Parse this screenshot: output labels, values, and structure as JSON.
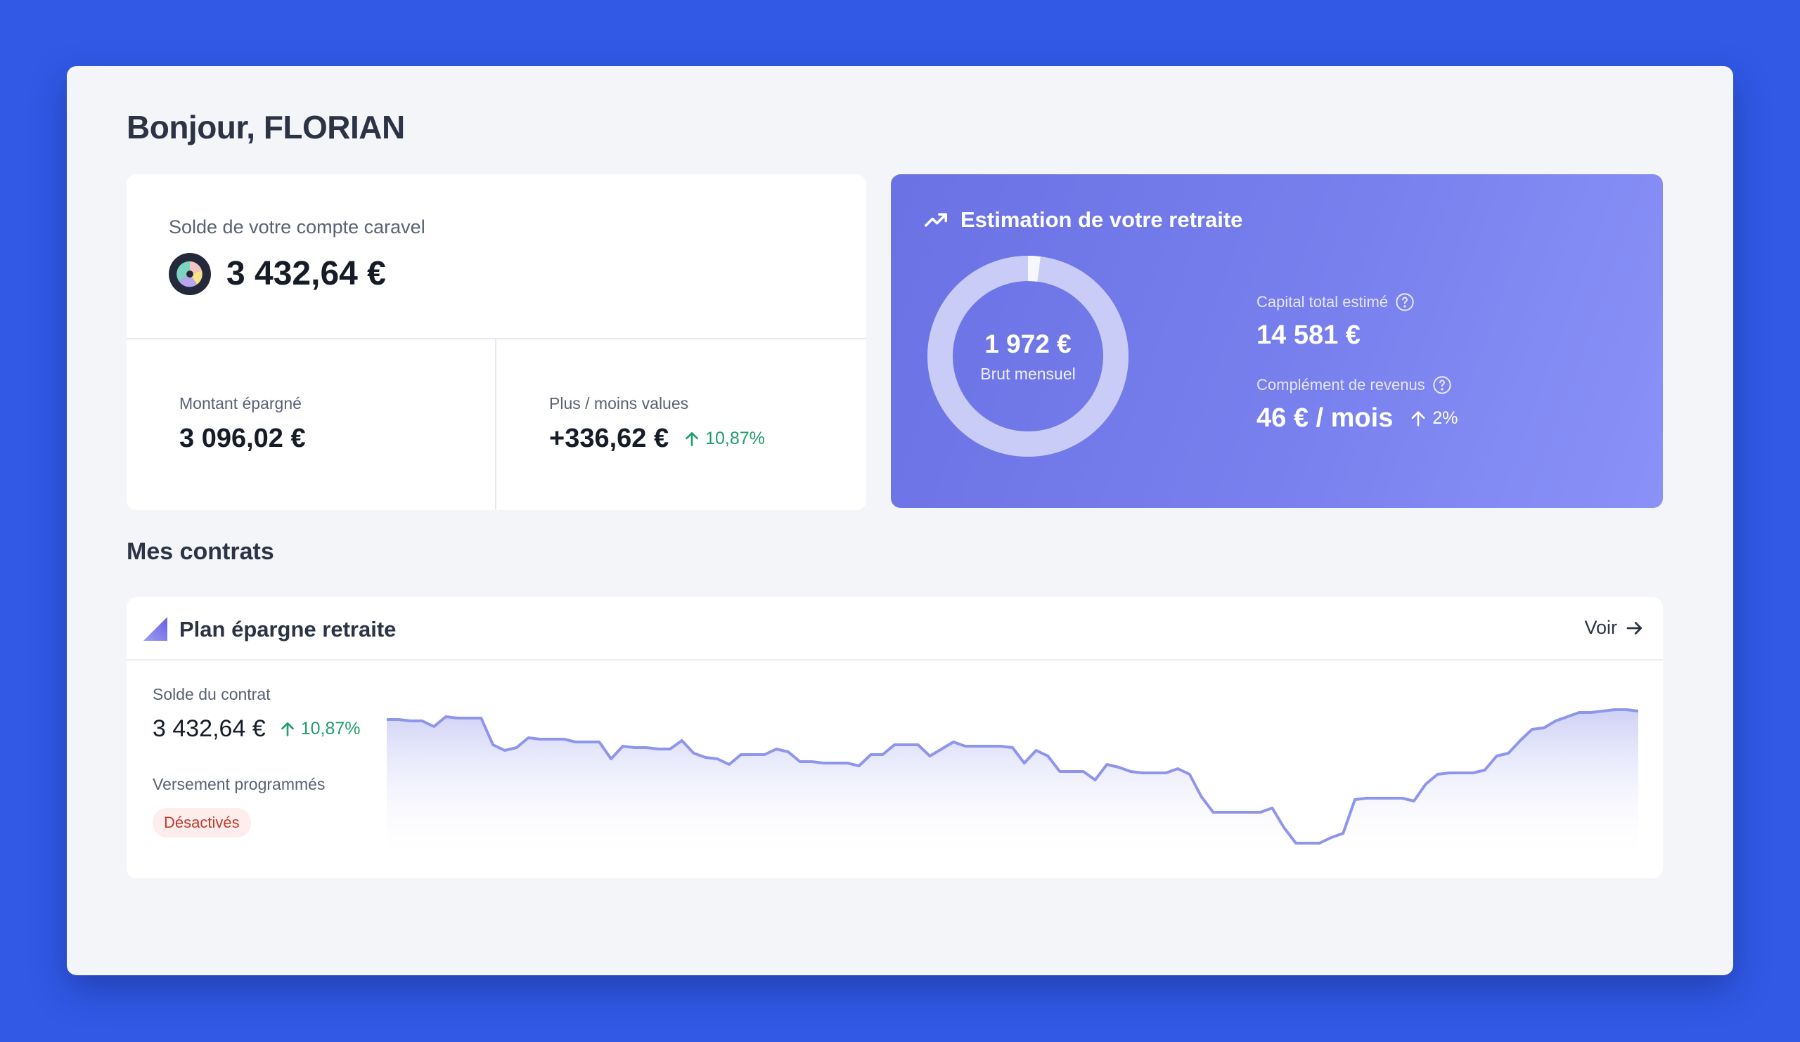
{
  "greeting": "Bonjour, FLORIAN",
  "balance": {
    "label": "Solde de votre compte caravel",
    "value": "3 432,64 €",
    "saved_label": "Montant épargné",
    "saved_value": "3 096,02 €",
    "gains_label": "Plus / moins values",
    "gains_value": "+336,62 €",
    "gains_trend": "10,87%"
  },
  "retirement": {
    "title": "Estimation de votre retraite",
    "donut_value": "1 972 €",
    "donut_sub": "Brut mensuel",
    "donut_fill_fraction": 0.02,
    "capital_label": "Capital total estimé",
    "capital_value": "14 581 €",
    "income_label": "Complément de revenus",
    "income_value": "46 € / mois",
    "income_trend": "2%"
  },
  "section_title": "Mes contrats",
  "contract": {
    "name": "Plan épargne retraite",
    "view_label": "Voir",
    "balance_label": "Solde du contrat",
    "balance_value": "3 432,64 €",
    "balance_trend": "10,87%",
    "scheduled_label": "Versement programmés",
    "scheduled_status": "Désactivés"
  },
  "colors": {
    "accent": "#6a72e4",
    "positive": "#1f9d6b",
    "negative": "#c0392b",
    "chart_line": "#8e95ec"
  },
  "chart_data": {
    "type": "area",
    "values": [
      88,
      88,
      87,
      87,
      83,
      90,
      89,
      89,
      89,
      70,
      66,
      68,
      75,
      74,
      74,
      74,
      72,
      72,
      72,
      60,
      69,
      68,
      68,
      67,
      67,
      73,
      64,
      61,
      60,
      56,
      63,
      63,
      63,
      67,
      65,
      58,
      58,
      57,
      57,
      57,
      55,
      63,
      63,
      70,
      70,
      70,
      62,
      67,
      72,
      69,
      69,
      69,
      69,
      68,
      57,
      66,
      62,
      51,
      51,
      51,
      45,
      56,
      54,
      51,
      50,
      50,
      50,
      53,
      49,
      33,
      22,
      22,
      22,
      22,
      22,
      25,
      11,
      0,
      0,
      0,
      4,
      7,
      31,
      32,
      32,
      32,
      32,
      30,
      42,
      49,
      50,
      50,
      50,
      52,
      62,
      64,
      73,
      81,
      82,
      87,
      90,
      93,
      93,
      94,
      95,
      95,
      94
    ]
  }
}
